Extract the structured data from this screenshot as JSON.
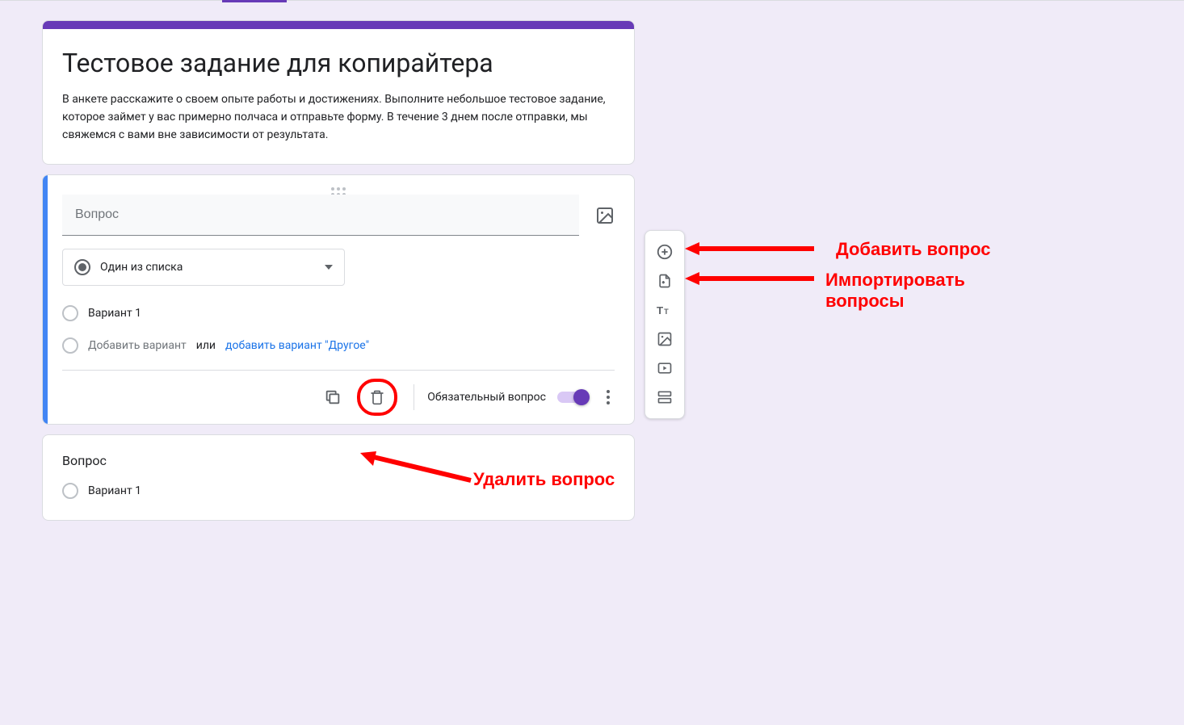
{
  "form": {
    "title": "Тестовое задание для копирайтера",
    "description": "В анкете расскажите о своем опыте работы и достижениях. Выполните небольшое тестовое задание, которое займет у вас примерно полчаса и отправьте форму. В течение 3 днем после отправки, мы свяжемся с вами вне зависимости от результата."
  },
  "active_question": {
    "placeholder": "Вопрос",
    "type_label": "Один из списка",
    "option1": "Вариант 1",
    "add_option": "Добавить вариант",
    "or": "или",
    "add_other": "добавить вариант \"Другое\"",
    "required_label": "Обязательный вопрос"
  },
  "inactive_question": {
    "title": "Вопрос",
    "option1": "Вариант 1"
  },
  "annotations": {
    "add_question": "Добавить вопрос",
    "import_line1": "Импортировать",
    "import_line2": "вопросы",
    "delete_question": "Удалить вопрос"
  }
}
